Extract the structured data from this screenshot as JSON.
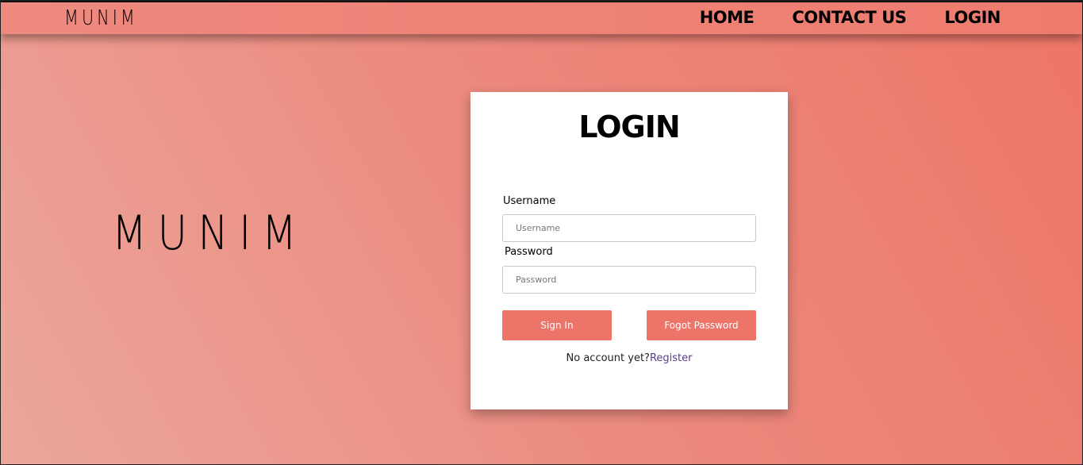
{
  "nav": {
    "brand": "MUNIM",
    "links": [
      "HOME",
      "CONTACT US",
      "LOGIN"
    ]
  },
  "hero": {
    "logo": "MUNIM"
  },
  "login": {
    "title": "LOGIN",
    "username_label": "Username",
    "username_placeholder": "Username",
    "password_label": "Password",
    "password_placeholder": "Password",
    "signin_label": "Sign In",
    "forgot_label": "Fogot Password",
    "no_account_text": "No account yet?",
    "register_label": "Register"
  },
  "colors": {
    "accent": "#ec7468",
    "link": "#5a3a8c"
  }
}
